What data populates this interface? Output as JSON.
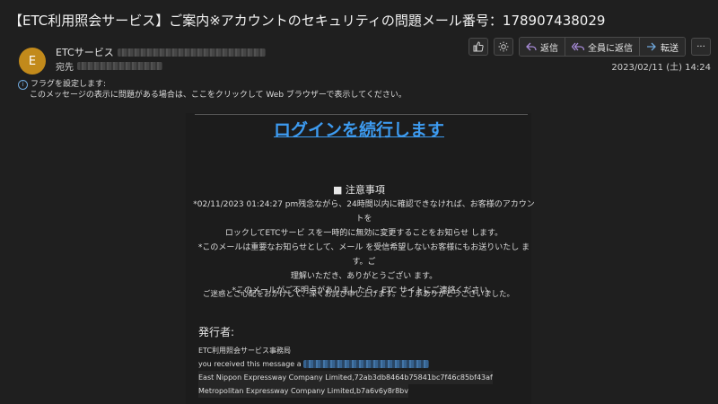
{
  "header": {
    "subject": "【ETC利用照会サービス】ご案内※アカウントのセキュリティの問題メール番号：178907438029",
    "avatar_initial": "E",
    "avatar_color": "#c28a1b",
    "sender_name": "ETCサービス",
    "to_label": "宛先",
    "date": "2023/02/11 (土) 14:24"
  },
  "toolbar": {
    "reply": "返信",
    "reply_all": "全員に返信",
    "forward": "転送",
    "more": "···"
  },
  "infobar": {
    "flag": "フラグを設定します:",
    "display_issue": "このメッセージの表示に問題がある場合は、ここをクリックして Web ブラウザーで表示してください。"
  },
  "body": {
    "login_link": "ログインを続行します",
    "notice_title": "■ 注意事項",
    "notice_line1": "*02/11/2023 01:24:27 pm残念ながら、24時間以内に確認できなければ、お客様のアカウントを",
    "notice_line2": "ロックしてETCサービ スを一時的に無効に変更することをお知らせ します。",
    "notice_line3": "*このメールは重要なお知らせとして、メール を受信希望しないお客様にもお送りいたし ます。ご",
    "notice_line4": "理解いただき、ありがとうござい ます。",
    "notice_line5": "*このメールがご不明点がありましたら、ETC サイトにご連絡ください。",
    "apology": "ご迷惑とご心配をおかけして、深くお詫び申し上げます。ご了承ありがとうございました。",
    "issuer_label": "発行者:",
    "issuer_org": "ETC利用照会サービス事務局",
    "received_prefix": "you received this message a",
    "line_east": "East Nippon Expressway Company Limited,72ab3db8464b75841bc7f46c85bf43af",
    "line_metro": "Metropolitan Expressway Company Limited,b7a6v6y8r8bv"
  },
  "colors": {
    "background": "#1f1f1f",
    "link": "#3d9bf0",
    "accent_reply": "#a78bd8",
    "accent_forward": "#6fa8dc"
  }
}
